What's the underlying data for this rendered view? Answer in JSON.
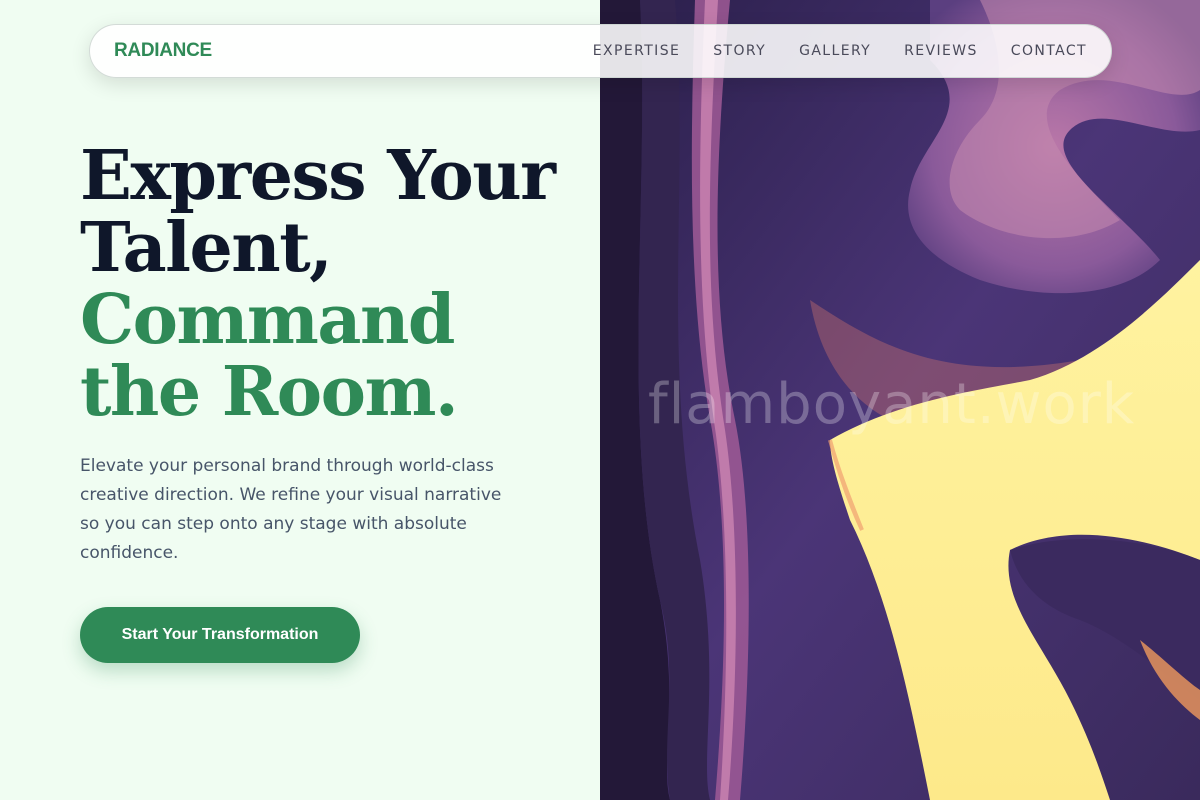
{
  "brand": {
    "logo": "RADIANCE"
  },
  "nav": {
    "links": [
      "EXPERTISE",
      "STORY",
      "GALLERY",
      "REVIEWS",
      "CONTACT"
    ]
  },
  "hero": {
    "title_line1": "Express Your",
    "title_line2": "Talent,",
    "title_accent_line1": "Command",
    "title_accent_line2": "the Room.",
    "description": "Elevate your personal brand through world-class creative direction. We refine your visual narrative so you can step onto any stage with absolute confidence.",
    "cta_label": "Start Your Transformation"
  },
  "artwork": {
    "watermark": "flamboyant.work"
  },
  "colors": {
    "background": "#f0fdf2",
    "accent": "#2f8a57",
    "heading": "#0f172a",
    "body_text": "#475569"
  }
}
